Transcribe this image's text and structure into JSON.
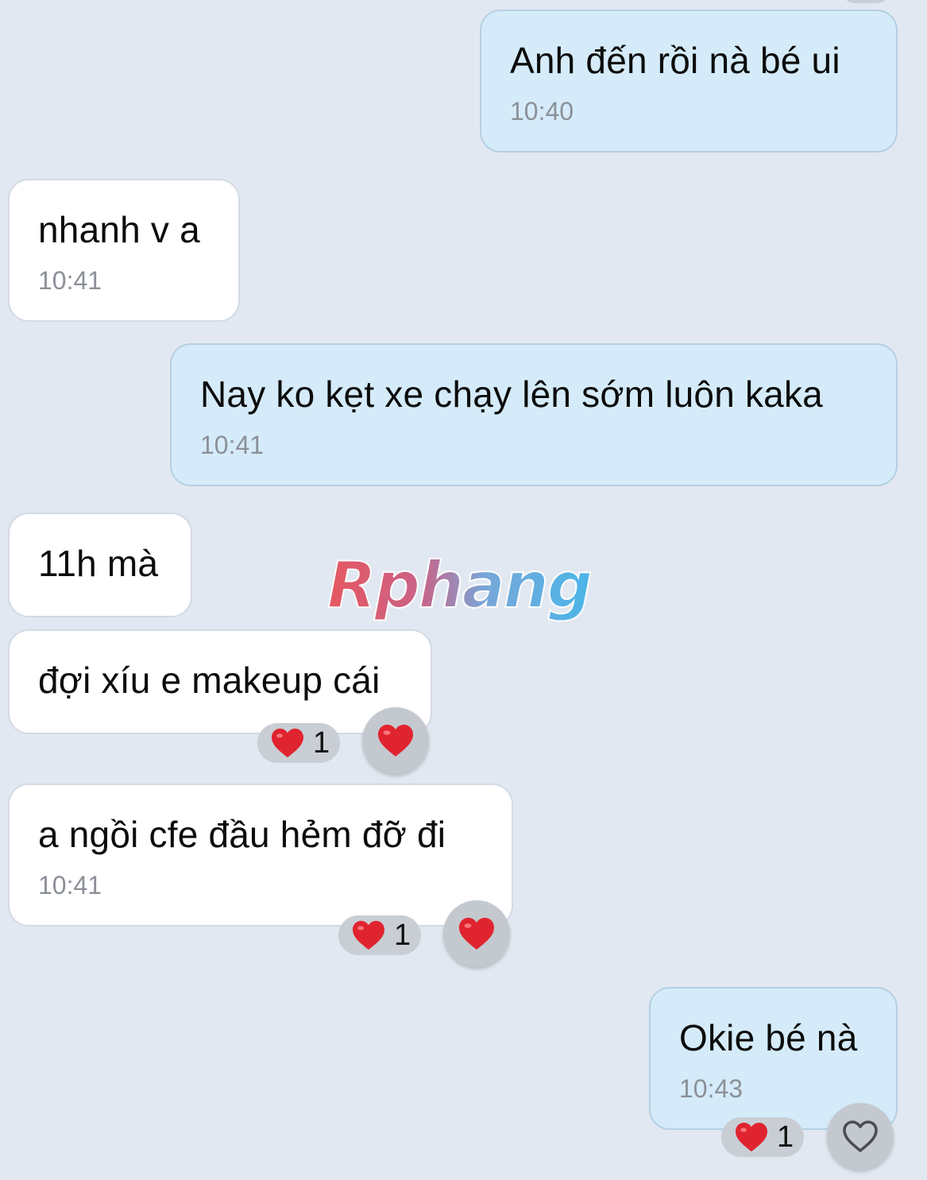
{
  "messages": [
    {
      "id": "m1",
      "direction": "out",
      "text": "Anh đến rồi nà bé ui",
      "time": "10:40"
    },
    {
      "id": "m2",
      "direction": "in",
      "text": "nhanh v a",
      "time": "10:41"
    },
    {
      "id": "m3",
      "direction": "out",
      "text": "Nay ko kẹt xe chạy lên sớm luôn kaka",
      "time": "10:41"
    },
    {
      "id": "m4",
      "direction": "in",
      "text": "11h mà",
      "time": ""
    },
    {
      "id": "m5",
      "direction": "in",
      "text": "đợi xíu e makeup cái",
      "time": "",
      "reaction": {
        "emoji": "heart-icon",
        "count": "1"
      }
    },
    {
      "id": "m6",
      "direction": "in",
      "text": "a ngồi cfe đầu hẻm đỡ đi",
      "time": "10:41",
      "reaction": {
        "emoji": "heart-icon",
        "count": "1"
      }
    },
    {
      "id": "m7",
      "direction": "out",
      "text": "Okie bé nà",
      "time": "10:43",
      "reaction": {
        "emoji": "heart-icon",
        "count": "1"
      }
    }
  ],
  "watermark": {
    "text": "Rphang"
  },
  "colors": {
    "background": "#e2e8f1",
    "incoming_bubble": "#ffffff",
    "outgoing_bubble": "#d5ebfa",
    "heart": "#e0242f",
    "watermark_gradient": [
      "#e74c55",
      "#3fb2e8"
    ]
  }
}
